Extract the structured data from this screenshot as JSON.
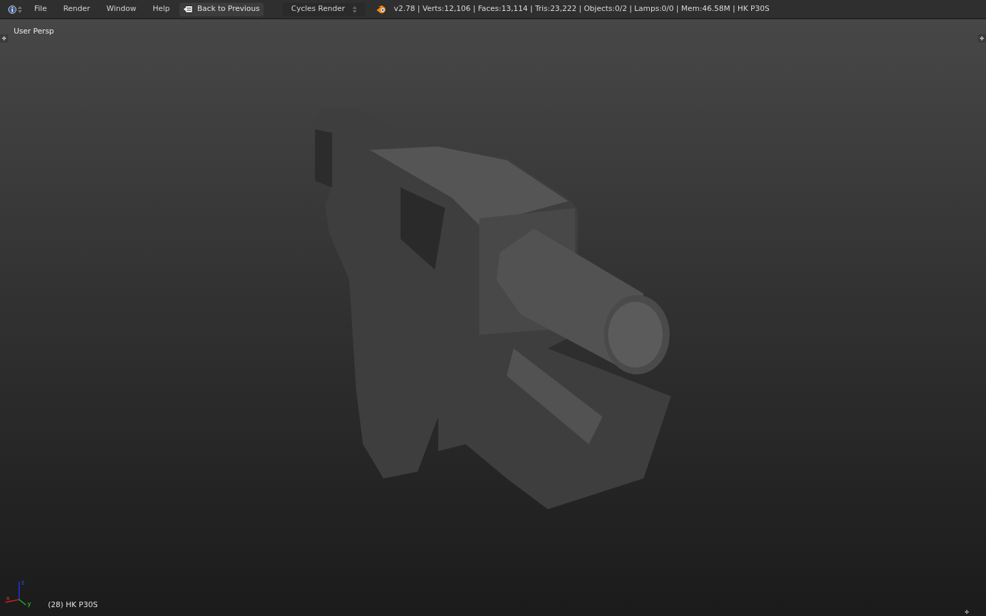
{
  "header": {
    "menus": [
      "File",
      "Render",
      "Window",
      "Help"
    ],
    "back_button": "Back to Previous",
    "render_engine": "Cycles Render",
    "stats": "v2.78 | Verts:12,106 | Faces:13,114 | Tris:23,222 | Objects:0/2 | Lamps:0/0 | Mem:46.58M | HK P30S"
  },
  "viewport": {
    "view_label": "User Persp",
    "object_label": "(28) HK P30S",
    "axes": [
      "x",
      "y",
      "z"
    ]
  }
}
